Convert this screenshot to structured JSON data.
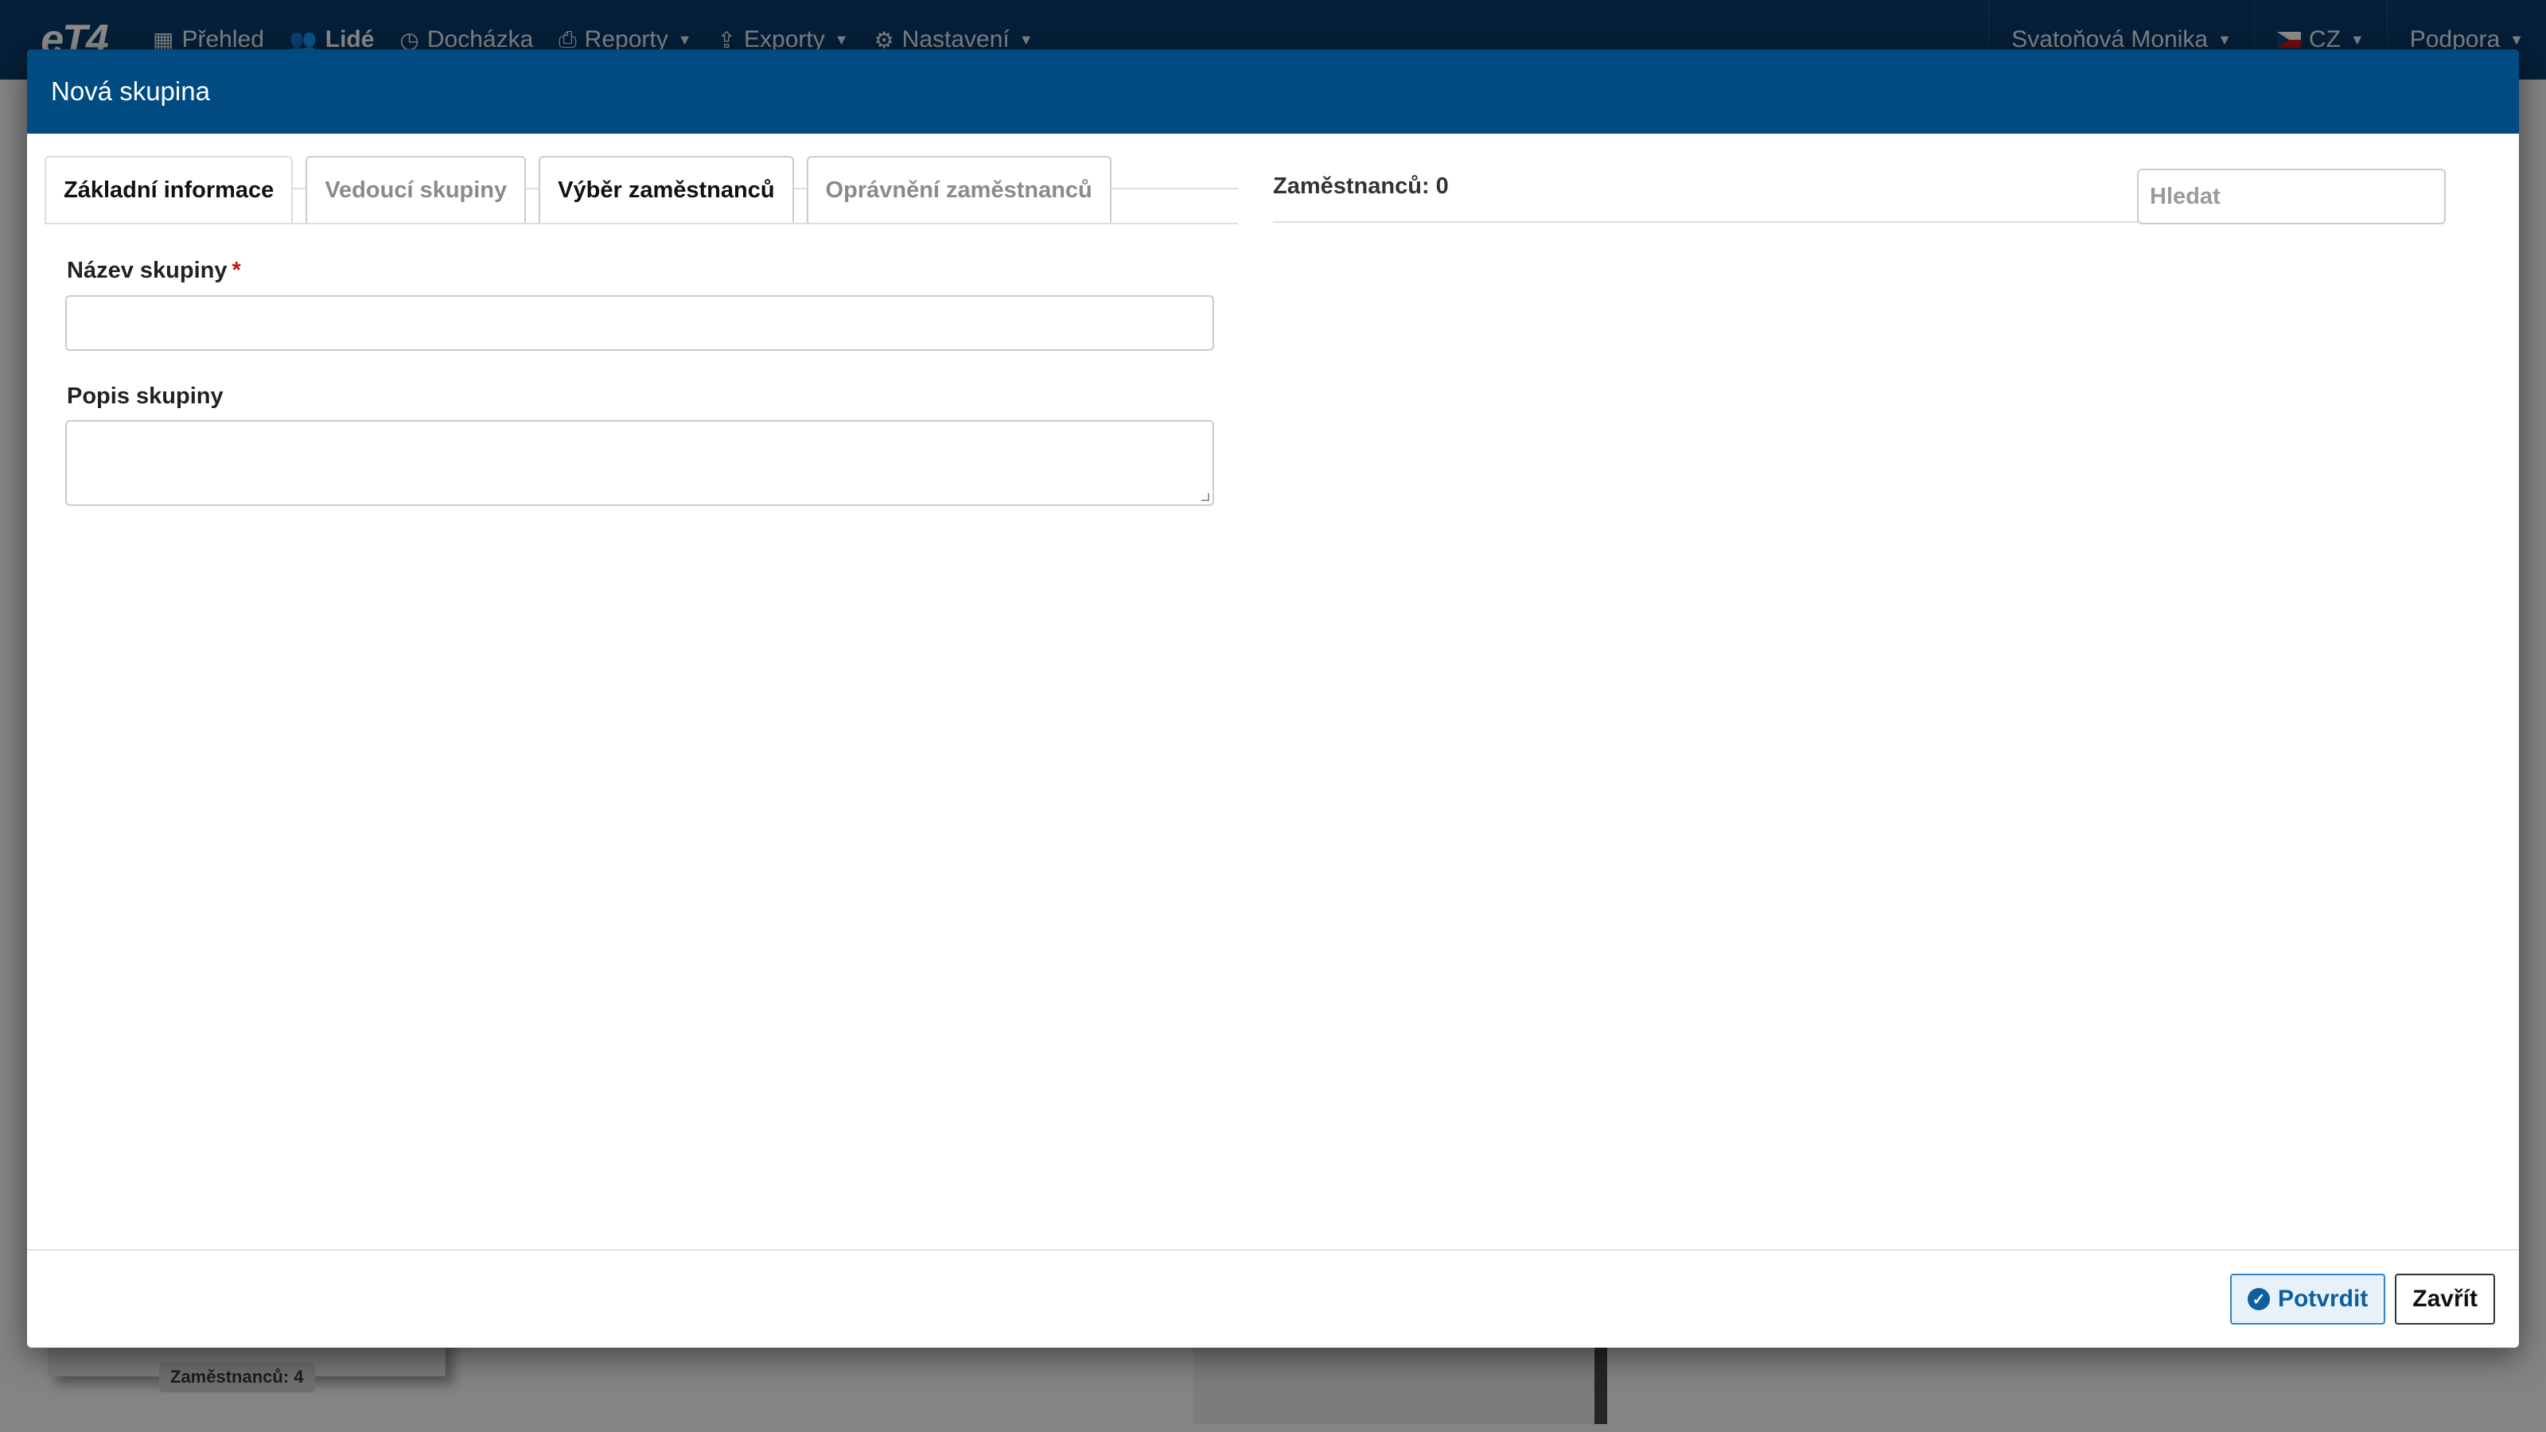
{
  "background": {
    "nav": {
      "logo": "eT4",
      "items": [
        {
          "label": "Přehled",
          "icon": "grid-icon"
        },
        {
          "label": "Lidé",
          "icon": "users-icon",
          "active": true
        },
        {
          "label": "Docházka",
          "icon": "clock-icon"
        },
        {
          "label": "Reporty",
          "icon": "printer-icon",
          "dropdown": true
        },
        {
          "label": "Exporty",
          "icon": "export-icon",
          "dropdown": true
        },
        {
          "label": "Nastavení",
          "icon": "gear-icon",
          "dropdown": true
        }
      ],
      "user": "Svatoňová Monika",
      "language": "CZ",
      "support": "Podpora"
    },
    "badge": "Zaměstnanců: 4"
  },
  "modal": {
    "title": "Nová skupina",
    "tabs": [
      {
        "label": "Základní informace",
        "active": true
      },
      {
        "label": "Vedoucí skupiny"
      },
      {
        "label": "Výběr zaměstnanců"
      },
      {
        "label": "Oprávnění zaměstnanců"
      }
    ],
    "form": {
      "name_label": "Název skupiny",
      "required_mark": "*",
      "name_value": "",
      "description_label": "Popis skupiny",
      "description_value": ""
    },
    "employees": {
      "label": "Zaměstnanců:",
      "count": "0",
      "search_placeholder": "Hledat"
    },
    "footer": {
      "confirm_label": "Potvrdit",
      "close_label": "Zavřít"
    }
  },
  "colors": {
    "header": "#004b82",
    "topbar": "#0a3a66",
    "required": "#cc1111",
    "confirm_border": "#2f86c9"
  }
}
